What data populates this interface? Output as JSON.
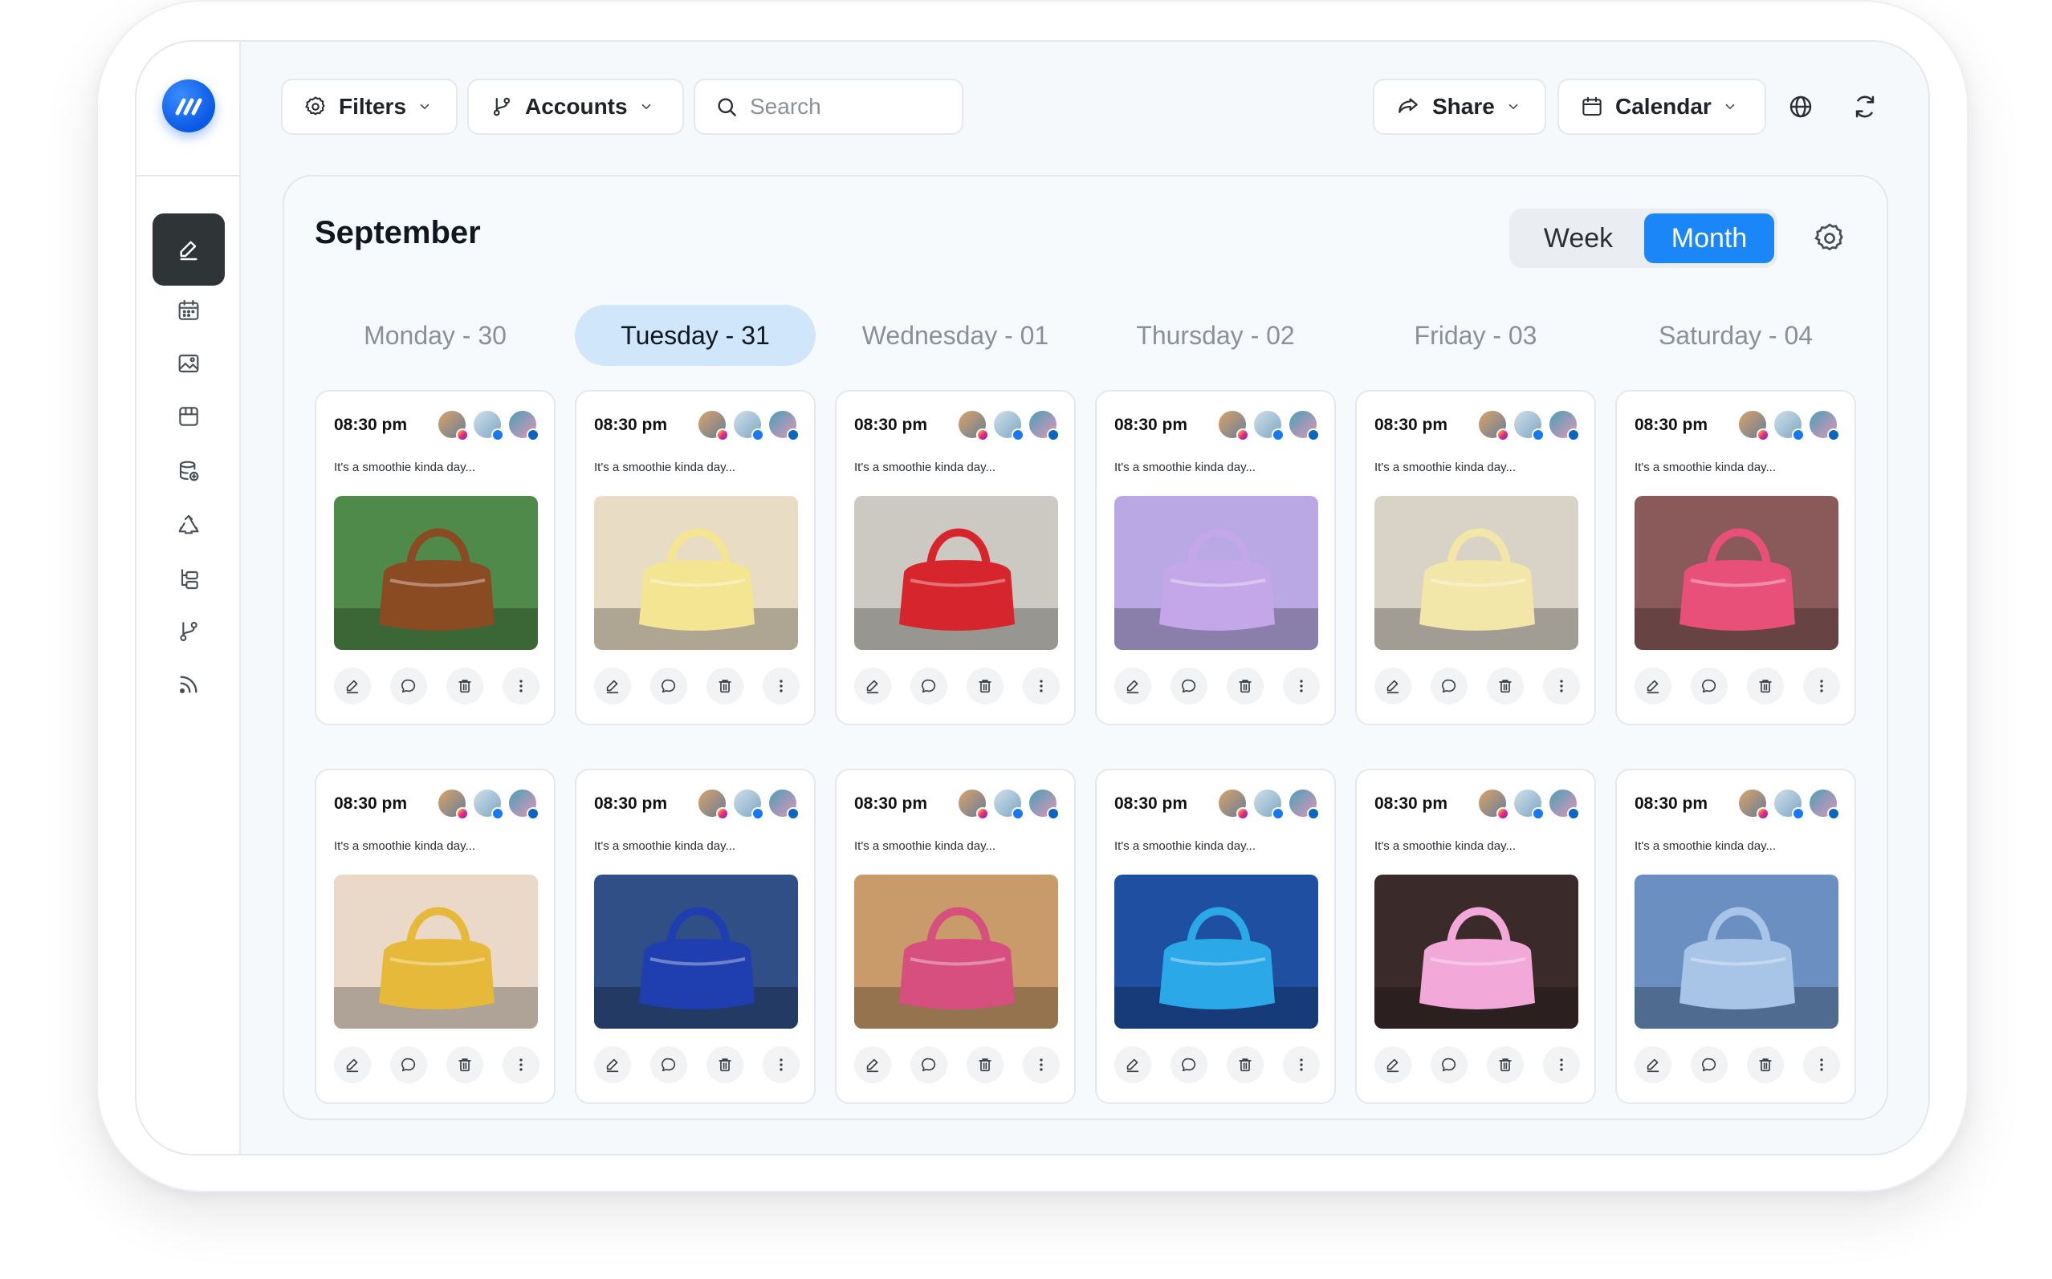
{
  "toolbar": {
    "filters_label": "Filters",
    "accounts_label": "Accounts",
    "search_placeholder": "Search",
    "share_label": "Share",
    "calendar_label": "Calendar"
  },
  "calendar": {
    "month_title": "September",
    "view_options": [
      "Week",
      "Month"
    ],
    "selected_view": "Month",
    "days": [
      "Monday - 30",
      "Tuesday - 31",
      "Wednesday - 01",
      "Thursday - 02",
      "Friday - 03",
      "Saturday - 04"
    ],
    "active_day": "Tuesday - 31"
  },
  "posts": [
    {
      "time": "08:30 pm",
      "caption": "It's a smoothie kinda day...",
      "bg": "#4f8a4a",
      "bag": "#8a4a22",
      "item": "brown hobo bag"
    },
    {
      "time": "08:30 pm",
      "caption": "It's a smoothie kinda day...",
      "bg": "#e8dcc4",
      "bag": "#f3e592",
      "item": "yellow handbag"
    },
    {
      "time": "08:30 pm",
      "caption": "It's a smoothie kinda day...",
      "bg": "#cbc9c2",
      "bag": "#d6252c",
      "item": "red bag"
    },
    {
      "time": "08:30 pm",
      "caption": "It's a smoothie kinda day...",
      "bg": "#b9a8e3",
      "bag": "#c4a7e8",
      "item": "lilac clutch"
    },
    {
      "time": "08:30 pm",
      "caption": "It's a smoothie kinda day...",
      "bg": "#d9d2c6",
      "bag": "#f2e7a8",
      "item": "pale yellow bag"
    },
    {
      "time": "08:30 pm",
      "caption": "It's a smoothie kinda day...",
      "bg": "#8a5a5a",
      "bag": "#e8507a",
      "item": "pink bag"
    },
    {
      "time": "08:30 pm",
      "caption": "It's a smoothie kinda day...",
      "bg": "#ead9c8",
      "bag": "#e6b93a",
      "item": "mustard bag"
    },
    {
      "time": "08:30 pm",
      "caption": "It's a smoothie kinda day...",
      "bg": "#2f4f86",
      "bag": "#1f3fb0",
      "item": "cobalt bag"
    },
    {
      "time": "08:30 pm",
      "caption": "It's a smoothie kinda day...",
      "bg": "#c99a6a",
      "bag": "#d64f7e",
      "item": "magenta bag"
    },
    {
      "time": "08:30 pm",
      "caption": "It's a smoothie kinda day...",
      "bg": "#1f4fa0",
      "bag": "#2aa8e8",
      "item": "sky blue bag"
    },
    {
      "time": "08:30 pm",
      "caption": "It's a smoothie kinda day...",
      "bg": "#3a2a2a",
      "bag": "#f2a8d8",
      "item": "pink clutch"
    },
    {
      "time": "08:30 pm",
      "caption": "It's a smoothie kinda day...",
      "bg": "#6b8fc0",
      "bag": "#a8c4e6",
      "item": "baby blue bag"
    }
  ],
  "sidebar_icons": [
    "edit-icon",
    "calendar-icon",
    "media-icon",
    "store-icon",
    "database-icon",
    "recycle-icon",
    "hierarchy-icon",
    "branch-icon",
    "rss-icon"
  ],
  "colors": {
    "accent": "#1b86f8",
    "active_day_bg": "#cfe6fb",
    "sidebar_active": "#2f3437"
  }
}
